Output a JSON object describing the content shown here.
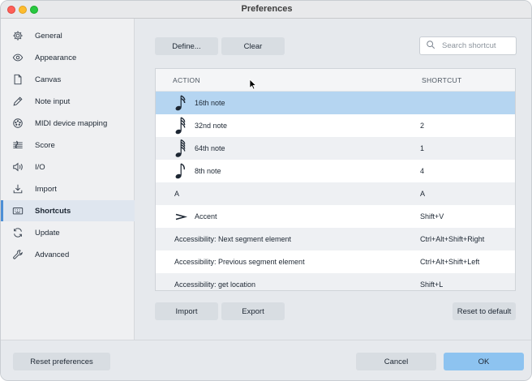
{
  "window": {
    "title": "Preferences"
  },
  "sidebar": {
    "items": [
      {
        "label": "General",
        "icon": "gear-icon"
      },
      {
        "label": "Appearance",
        "icon": "eye-icon"
      },
      {
        "label": "Canvas",
        "icon": "document-icon"
      },
      {
        "label": "Note input",
        "icon": "pencil-icon"
      },
      {
        "label": "MIDI device mapping",
        "icon": "midi-icon"
      },
      {
        "label": "Score",
        "icon": "score-icon"
      },
      {
        "label": "I/O",
        "icon": "speaker-icon"
      },
      {
        "label": "Import",
        "icon": "import-icon"
      },
      {
        "label": "Shortcuts",
        "icon": "keyboard-icon",
        "active": true
      },
      {
        "label": "Update",
        "icon": "refresh-icon"
      },
      {
        "label": "Advanced",
        "icon": "wrench-icon"
      }
    ]
  },
  "toolbar": {
    "define_label": "Define...",
    "clear_label": "Clear"
  },
  "search": {
    "placeholder": "Search shortcut",
    "value": ""
  },
  "table": {
    "columns": {
      "action": "ACTION",
      "shortcut": "SHORTCUT"
    },
    "rows": [
      {
        "action": "16th note",
        "shortcut": "",
        "icon": "sixteenth-note-icon",
        "selected": true
      },
      {
        "action": "32nd note",
        "shortcut": "2",
        "icon": "thirty-second-note-icon"
      },
      {
        "action": "64th note",
        "shortcut": "1",
        "icon": "sixty-fourth-note-icon"
      },
      {
        "action": "8th note",
        "shortcut": "4",
        "icon": "eighth-note-icon"
      },
      {
        "action": "A",
        "shortcut": "A"
      },
      {
        "action": "Accent",
        "shortcut": "Shift+V",
        "icon": "accent-icon"
      },
      {
        "action": "Accessibility: Next segment element",
        "shortcut": "Ctrl+Alt+Shift+Right"
      },
      {
        "action": "Accessibility: Previous segment element",
        "shortcut": "Ctrl+Alt+Shift+Left"
      },
      {
        "action": "Accessibility: get location",
        "shortcut": "Shift+L"
      }
    ]
  },
  "bottom": {
    "import_label": "Import",
    "export_label": "Export",
    "reset_default_label": "Reset to default"
  },
  "footer": {
    "reset_prefs_label": "Reset preferences",
    "cancel_label": "Cancel",
    "ok_label": "OK"
  },
  "colors": {
    "accent": "#4c8fd6",
    "selected_row": "#b5d5f1",
    "ok_button": "#8dc3f0"
  }
}
